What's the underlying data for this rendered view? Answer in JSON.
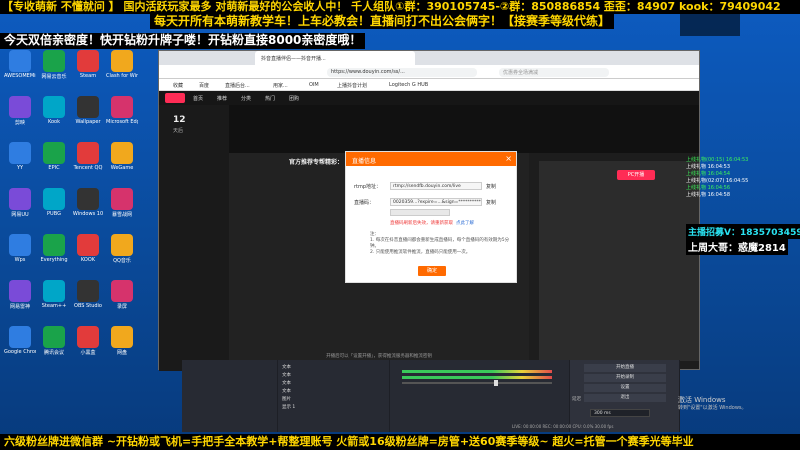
{
  "overlay_banners": {
    "top_ticker": "【专收萌新 不懂就问 】 国内活跃玩家最多 对萌新最好的公会收人中！ 千人组队①群：390105745-②群：850886854 歪歪：84907 kook：79409042",
    "second_line": "每天开所有本萌新教学车！上车必教会！直播间打不出公会俩字！【接赛季等级代练】",
    "third_line": "今天双倍亲密度！快开钻粉升牌子喽！开钻粉直接8000亲密度哦！",
    "bottom_ticker": "六级粉丝牌进微信群 ~开钻粉或飞机=手把手全本教学+帮整理账号 火箭或16级粉丝牌=房管+送60赛季等级~ 超火=托管一个赛季光等毕业"
  },
  "right_overlay": {
    "streamer_line": "主播招募V：1835703459",
    "leader_line": "上周大哥：惑魔2814",
    "chat_lines": [
      "上线礼物(00:15) 16:04:53",
      "上线礼物 16:04:53",
      "上线礼物 16:04:54",
      "上线礼物(02:07) 16:04:55",
      "上线礼物 16:04:56",
      "上线礼物 16:04:58"
    ]
  },
  "desktop": {
    "icons": [
      "AWESOMEMiner",
      "网易云音乐",
      "Steam",
      "Clash for Windows",
      "剪映",
      "Kook",
      "Wallpaper",
      "Microsoft Edge",
      "YY",
      "EPIC",
      "Tencent QQ",
      "WeGame",
      "网易UU",
      "PUBG",
      "Windows 10",
      "暴雪战网",
      "Wps",
      "Everything",
      "KOOK",
      "QQ音乐",
      "网易雷神",
      "Steam++",
      "OBS Studio",
      "录屏",
      "Google Chrome",
      "腾讯会议",
      "小黑盒",
      "网盘"
    ]
  },
  "browser": {
    "tab_title": "抖音直播伴侣——抖音开播...",
    "url": "https://www.douyin.com/ss/...",
    "search_placeholder": "优惠券全场满减",
    "bookmarks": [
      "收藏",
      "百度",
      "直播后台...",
      "用家...",
      "OIM",
      "上播抖音计划",
      "Logitech G HUB"
    ],
    "page_menu": [
      "首页",
      "推荐",
      "分类",
      "热门",
      "团购"
    ],
    "panel_heading": "官方推荐专帮精彩：",
    "open_btn": "PC开播",
    "stat_number": "12",
    "stat_label": "天后",
    "footer_hint": "开播后可以「设置开播」，获得推流服务器和推流密钥"
  },
  "modal": {
    "title": "直播信息",
    "close_label": "×",
    "label_server": "rtmp地址：",
    "value_server": "rtmp://sendfb.douyin.com/live",
    "label_key": "直播码：",
    "value_key": "0020359...?expire=...&sign=***********",
    "copy_label": "复制",
    "warning_text": "直播码刷新后失效，请重新获取",
    "link_text": "点此了解",
    "notes": [
      "注：",
      "1. 每次在抖音直播间都会重新生成直播码，每个直播码的有效期为5分钟。",
      "2. 只能使用推流软件推流，直播码只能使用一次。"
    ],
    "ok_label": "确定"
  },
  "obs": {
    "sources": [
      "文本",
      "文本",
      "文本",
      "文本",
      "图片",
      "显示 1"
    ],
    "controls": [
      "开始直播",
      "开始录制",
      "设置",
      "退出"
    ],
    "status": "LIVE: 00:00:00   REC: 00:00:00   CPU: 0.0%   30.00 fps",
    "audio_label": "延迟",
    "delay_value": "300 ms"
  },
  "windows_activation": {
    "line1": "激活 Windows",
    "line2": "转到\"设置\"以激活 Windows。"
  }
}
